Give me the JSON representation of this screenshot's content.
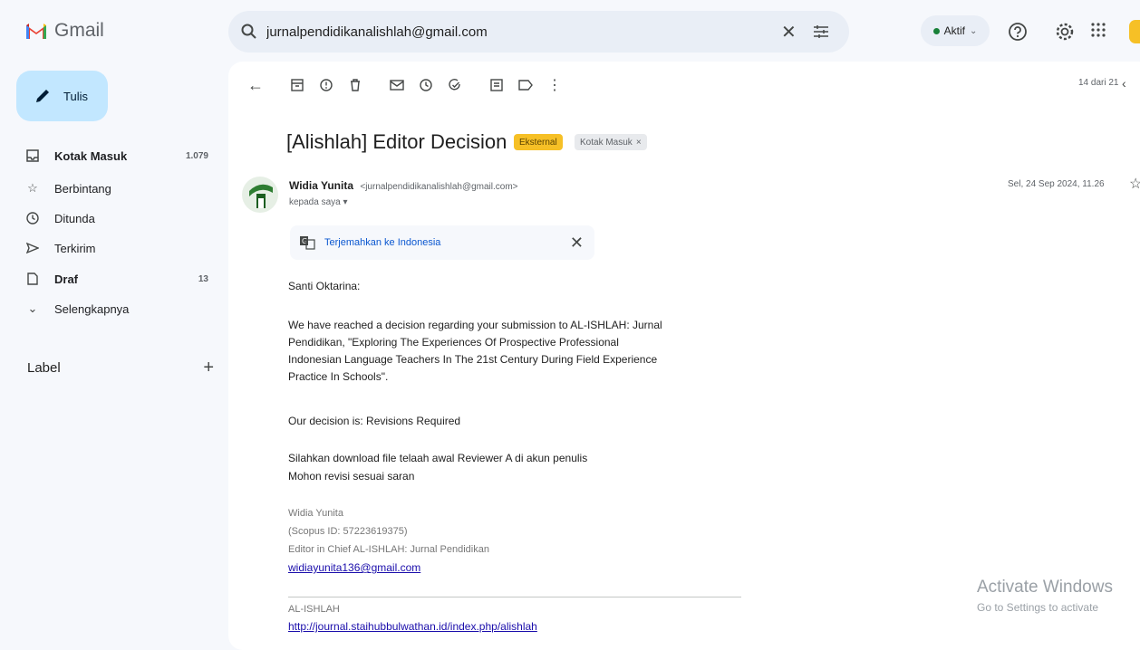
{
  "app": {
    "name": "Gmail"
  },
  "search": {
    "value": "jurnalpendidikanalishlah@gmail.com"
  },
  "status": {
    "label": "Aktif"
  },
  "compose": {
    "label": "Tulis"
  },
  "sidebar": {
    "items": [
      {
        "label": "Kotak Masuk",
        "count": "1.079",
        "icon": "inbox-icon",
        "bold": true
      },
      {
        "label": "Berbintang",
        "count": "",
        "icon": "star-icon"
      },
      {
        "label": "Ditunda",
        "count": "",
        "icon": "clock-icon"
      },
      {
        "label": "Terkirim",
        "count": "",
        "icon": "send-icon"
      },
      {
        "label": "Draf",
        "count": "13",
        "icon": "draft-icon",
        "bold": true
      },
      {
        "label": "Selengkapnya",
        "count": "",
        "icon": "chevron-down-icon"
      }
    ],
    "label_heading": "Label",
    "label_add": "+"
  },
  "pager": {
    "text": "14 dari 21"
  },
  "email": {
    "subject": "[Alishlah] Editor Decision",
    "labels": [
      "Eksternal",
      "Kotak Masuk"
    ],
    "sender_name": "Widia Yunita",
    "sender_email": "<jurnalpendidikanalishlah@gmail.com>",
    "to": "kepada saya",
    "date": "Sel, 24 Sep 2024, 11.26",
    "translate": "Terjemahkan ke Indonesia",
    "greeting": "Santi Oktarina:",
    "paragraph1": [
      "We have reached a decision regarding your submission to AL-ISHLAH: Jurnal",
      "Pendidikan, \"Exploring The Experiences Of Prospective Professional",
      "Indonesian Language Teachers In The 21st Century During Field Experience",
      "Practice In Schools\"."
    ],
    "decision": "Our decision is: Revisions Required",
    "instruction1": "Silahkan download file telaah awal Reviewer A di akun penulis",
    "instruction2": "Mohon revisi sesuai saran",
    "signature": {
      "name": "Widia Yunita",
      "scopus": "(Scopus ID: 57223619375)",
      "role": "Editor in Chief AL-ISHLAH: Jurnal Pendidikan",
      "email": "widiayunita136@gmail.com"
    },
    "footer_name": "AL-ISHLAH",
    "footer_url": "http://journal.staihubbulwathan.id/index.php/alishlah"
  },
  "watermark": {
    "title": "Activate Windows",
    "subtitle": "Go to Settings to activate"
  },
  "colors": {
    "compose_bg": "#c2e7ff",
    "external_label": "#f6c026",
    "link": "#1a0dab",
    "active_dot": "#188038"
  }
}
